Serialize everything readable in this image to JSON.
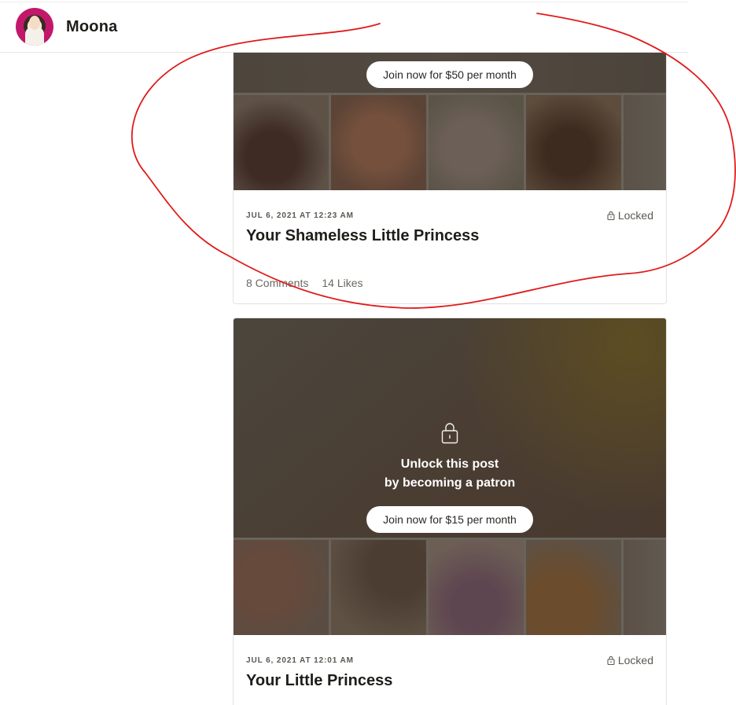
{
  "header": {
    "creator_name": "Moona"
  },
  "posts": [
    {
      "join_label": "Join now for $50 per month",
      "date": "JUL 6, 2021 AT 12:23 AM",
      "status": "Locked",
      "title": "Your Shameless Little Princess",
      "comments": "8 Comments",
      "likes": "14 Likes"
    },
    {
      "unlock_line1": "Unlock this post",
      "unlock_line2": "by becoming a patron",
      "join_label": "Join now for $15 per month",
      "date": "JUL 6, 2021 AT 12:01 AM",
      "status": "Locked",
      "title": "Your Little Princess"
    }
  ],
  "icons": {
    "lock": "lock-icon",
    "avatar": "avatar-image"
  },
  "colors": {
    "annotation": "#e01b1b",
    "button_bg": "#ffffff",
    "media_dark": "#4a4036"
  }
}
